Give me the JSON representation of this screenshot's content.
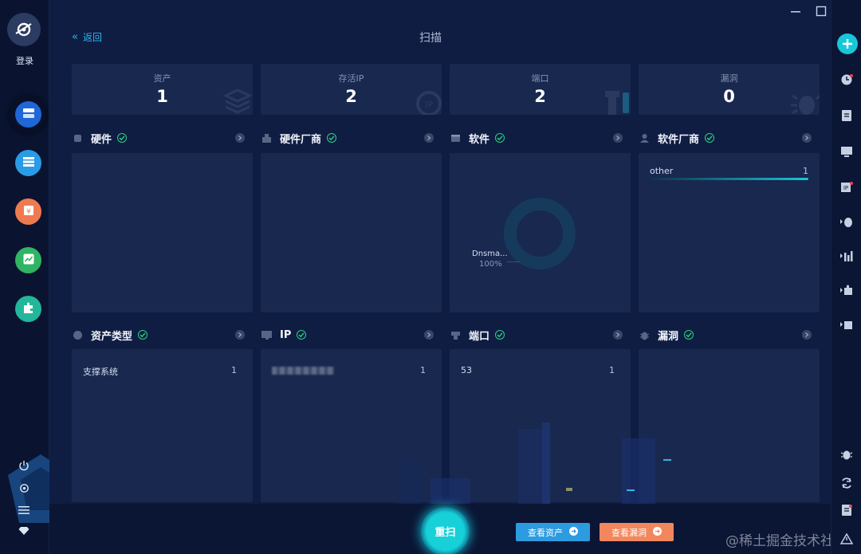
{
  "sidebar": {
    "login_label": "登录",
    "items": [
      {
        "icon": "asset-server-icon",
        "color": "#1f66d6"
      },
      {
        "icon": "list-icon",
        "color": "#2a9be6"
      },
      {
        "icon": "ticket-icon",
        "color": "#f07a50"
      },
      {
        "icon": "trend-chart-icon",
        "color": "#2fb463"
      },
      {
        "icon": "plugin-icon",
        "color": "#23b69a"
      }
    ]
  },
  "header": {
    "back_label": "返回",
    "title": "扫描"
  },
  "stats": [
    {
      "label": "资产",
      "value": "1"
    },
    {
      "label": "存活IP",
      "value": "2"
    },
    {
      "label": "端口",
      "value": "2"
    },
    {
      "label": "漏洞",
      "value": "0"
    }
  ],
  "sections": {
    "hardware": {
      "title": "硬件"
    },
    "hardware_vendor": {
      "title": "硬件厂商"
    },
    "software": {
      "title": "软件",
      "donut_label": "Dnsma...",
      "donut_percent": "100%"
    },
    "software_vendor": {
      "title": "软件厂商",
      "rows": [
        {
          "name": "other",
          "count": "1"
        }
      ]
    },
    "asset_type": {
      "title": "资产类型",
      "rows": [
        {
          "name": "支撑系统",
          "count": "1"
        }
      ]
    },
    "ip": {
      "title": "IP",
      "rows": [
        {
          "name": "",
          "count": "1"
        }
      ]
    },
    "port": {
      "title": "端口",
      "rows": [
        {
          "name": "53",
          "count": "1"
        }
      ]
    },
    "vuln": {
      "title": "漏洞"
    }
  },
  "actions": {
    "rescan": "重扫",
    "view_assets": "查看资产",
    "view_vulns": "查看漏洞"
  },
  "watermark": "@稀土掘金技术社区",
  "colors": {
    "accent": "#17c6d8",
    "ok": "#2bd17e",
    "view_assets_bg": "#2d9be0",
    "view_vulns_bg": "#f2875d"
  }
}
